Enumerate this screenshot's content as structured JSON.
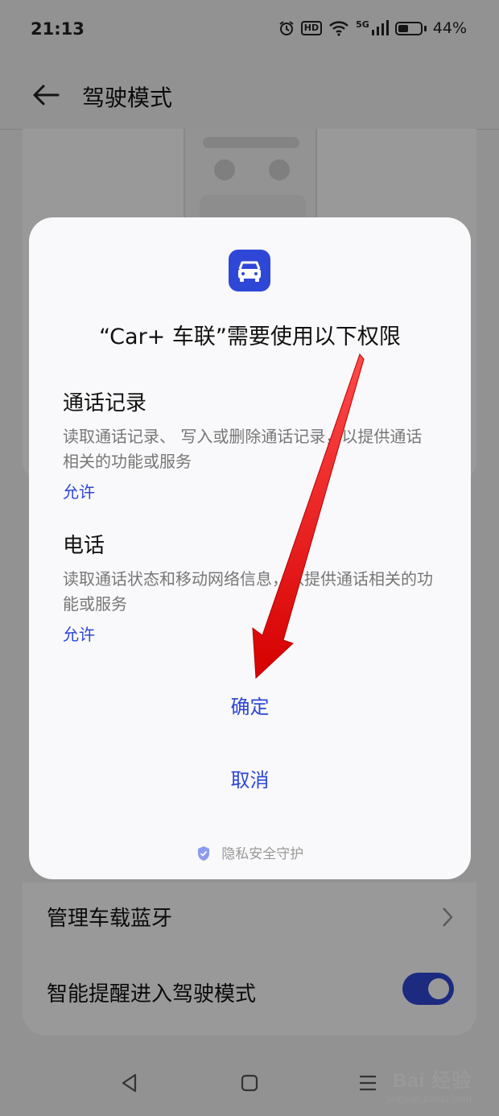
{
  "status_bar": {
    "time": "21:13",
    "hd": "HD",
    "network": "5G",
    "battery": "44%"
  },
  "header": {
    "title": "驾驶模式"
  },
  "settings": {
    "bluetooth_label": "管理车载蓝牙",
    "smart_reminder_label": "智能提醒进入驾驶模式",
    "smart_reminder_on": true
  },
  "dialog": {
    "title": "“Car+ 车联”需要使用以下权限",
    "permissions": [
      {
        "title": "通话记录",
        "description": "读取通话记录、 写入或删除通话记录，以提供通话相关的功能或服务",
        "status": "允许"
      },
      {
        "title": "电话",
        "description": "读取通话状态和移动网络信息，以提供通话相关的功能或服务",
        "status": "允许"
      }
    ],
    "confirm_label": "确定",
    "cancel_label": "取消",
    "footer": "隐私安全守护"
  },
  "watermark": {
    "brand": "Bai 经验",
    "url": "jingyan.baidu.com"
  },
  "colors": {
    "accent": "#2f47d6",
    "scrim": "rgba(0,0,0,0.40)"
  }
}
